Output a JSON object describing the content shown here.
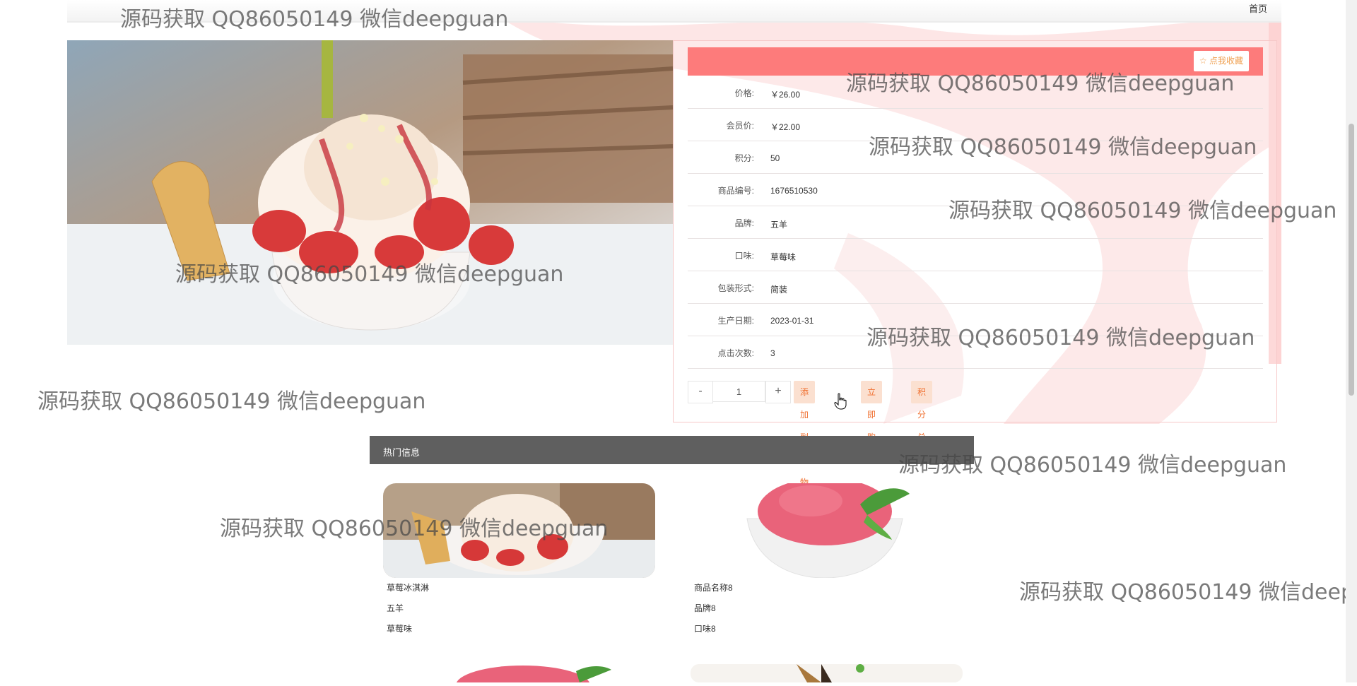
{
  "nav": {
    "home_label": "首页"
  },
  "product": {
    "fav_button": "☆ 点我收藏",
    "rows": [
      {
        "label": "价格:",
        "value": "￥26.00"
      },
      {
        "label": "会员价:",
        "value": "￥22.00"
      },
      {
        "label": "积分:",
        "value": "50"
      },
      {
        "label": "商品编号:",
        "value": "1676510530"
      },
      {
        "label": "品牌:",
        "value": "五羊"
      },
      {
        "label": "口味:",
        "value": "草莓味"
      },
      {
        "label": "包装形式:",
        "value": "简装"
      },
      {
        "label": "生产日期:",
        "value": "2023-01-31"
      },
      {
        "label": "点击次数:",
        "value": "3"
      }
    ],
    "quantity": "1",
    "minus": "-",
    "plus": "+",
    "add_to_cart": "添加到购物车",
    "buy_now": "立即购买",
    "points_exchange": "积分兑换"
  },
  "hot": {
    "title": "热门信息",
    "items": [
      {
        "name": "草莓冰淇淋",
        "brand": "五羊",
        "flavor": "草莓味"
      },
      {
        "name": "商品名称8",
        "brand": "品牌8",
        "flavor": "口味8"
      }
    ]
  },
  "watermark": "源码获取 QQ86050149 微信deepguan",
  "watermark_cut": "源码获取 QQ86050149 微信deepg",
  "colors": {
    "header_pink": "#fd7b7b",
    "button_bg": "#fbe0d0",
    "button_text": "#f07030",
    "hot_bar": "#5f5f5f"
  }
}
